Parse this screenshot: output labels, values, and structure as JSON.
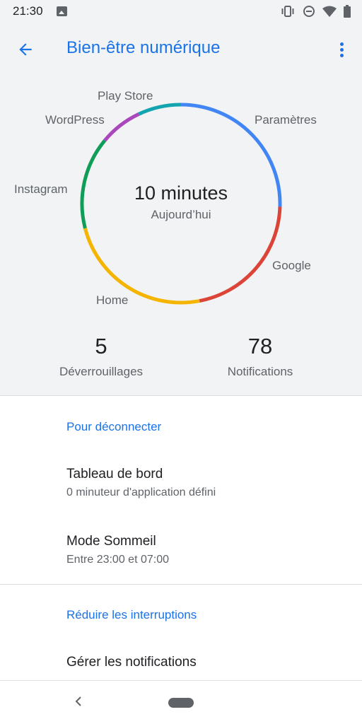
{
  "status_bar": {
    "time": "21:30",
    "icons": [
      "image-icon",
      "vibrate-icon",
      "do-not-disturb-icon",
      "wifi-icon",
      "battery-icon"
    ]
  },
  "header": {
    "title": "Bien-être numérique",
    "back_icon": "arrow-back-icon",
    "menu_icon": "more-vert-icon"
  },
  "usage": {
    "total": "10 minutes",
    "period": "Aujourd’hui",
    "apps": [
      {
        "name": "Paramètres",
        "color": "#4285f4",
        "share": 0.255
      },
      {
        "name": "Google",
        "color": "#db4437",
        "share": 0.215
      },
      {
        "name": "Home",
        "color": "#f4b400",
        "share": 0.24
      },
      {
        "name": "Instagram",
        "color": "#0f9d58",
        "share": 0.15
      },
      {
        "name": "WordPress",
        "color": "#ab47bc",
        "share": 0.07
      },
      {
        "name": "Play Store",
        "color": "#12a4af",
        "share": 0.07
      }
    ]
  },
  "stats": {
    "unlocks": {
      "value": "5",
      "label": "Déverrouillages"
    },
    "notifications": {
      "value": "78",
      "label": "Notifications"
    }
  },
  "sections": {
    "disconnect": {
      "header": "Pour déconnecter",
      "dashboard": {
        "title": "Tableau de bord",
        "subtitle": "0 minuteur d'application défini"
      },
      "sleep": {
        "title": "Mode Sommeil",
        "subtitle": "Entre 23:00 et 07:00"
      }
    },
    "interruptions": {
      "header": "Réduire les interruptions",
      "notifications": {
        "title": "Gérer les notifications"
      }
    }
  },
  "nav_bar": {
    "back_icon": "nav-back-icon",
    "home_icon": "home-pill-icon"
  }
}
